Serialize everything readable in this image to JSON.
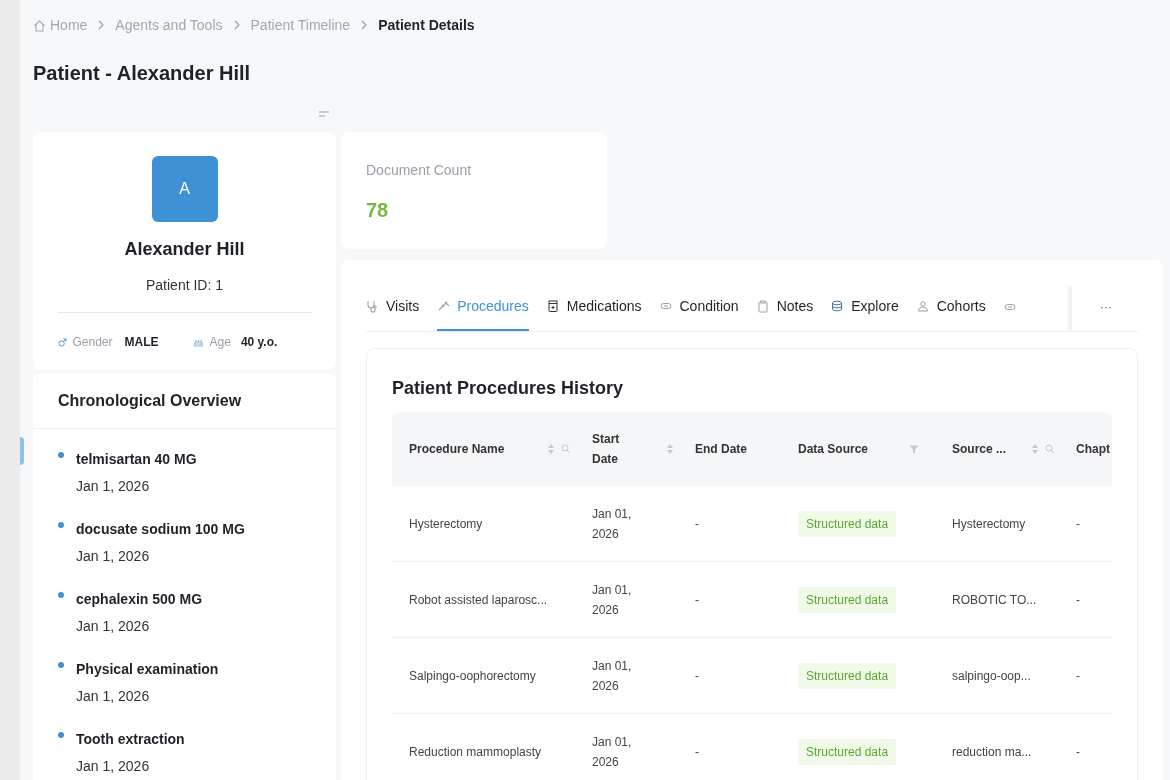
{
  "breadcrumb": [
    {
      "label": "Home",
      "kind": "home"
    },
    {
      "label": "Agents and Tools",
      "kind": "link"
    },
    {
      "label": "Patient Timeline",
      "kind": "link"
    },
    {
      "label": "Patient Details",
      "kind": "current"
    }
  ],
  "page_title": "Patient - Alexander Hill",
  "patient": {
    "initial": "A",
    "name": "Alexander Hill",
    "id_text": "Patient ID: 1",
    "gender_label": "Gender",
    "gender": "MALE",
    "age_label": "Age",
    "age": "40 y.o."
  },
  "chronological_overview": {
    "title": "Chronological Overview",
    "items": [
      {
        "title": "telmisartan 40 MG",
        "date": "Jan 1, 2026"
      },
      {
        "title": "docusate sodium 100 MG",
        "date": "Jan 1, 2026"
      },
      {
        "title": "cephalexin 500 MG",
        "date": "Jan 1, 2026"
      },
      {
        "title": "Physical examination",
        "date": "Jan 1, 2026"
      },
      {
        "title": "Tooth extraction",
        "date": "Jan 1, 2026"
      }
    ]
  },
  "document_count": {
    "label": "Document Count",
    "value": "78"
  },
  "tabs": [
    {
      "label": "Visits",
      "selected": false
    },
    {
      "label": "Procedures",
      "selected": true
    },
    {
      "label": "Medications",
      "selected": false
    },
    {
      "label": "Condition",
      "selected": false
    },
    {
      "label": "Notes",
      "selected": false
    },
    {
      "label": "Explore",
      "selected": false
    },
    {
      "label": "Cohorts",
      "selected": false
    }
  ],
  "more_tabs": "···",
  "table": {
    "title": "Patient Procedures History",
    "columns": [
      {
        "label": "Procedure Name",
        "sortable": true,
        "searchable": true,
        "filterable": false
      },
      {
        "label": "Start Date",
        "sortable": true,
        "searchable": false,
        "filterable": false
      },
      {
        "label": "End Date",
        "sortable": false,
        "searchable": false,
        "filterable": false
      },
      {
        "label": "Data Source",
        "sortable": false,
        "searchable": false,
        "filterable": true
      },
      {
        "label": "Source ...",
        "sortable": true,
        "searchable": true,
        "filterable": false
      },
      {
        "label": "Chapt"
      }
    ],
    "rows": [
      [
        "Hysterectomy",
        "Jan 01, 2026",
        "-",
        "Structured data",
        "Hysterectomy",
        "-"
      ],
      [
        "Robot assisted laparosc...",
        "Jan 01, 2026",
        "-",
        "Structured data",
        "ROBOTIC TO...",
        "-"
      ],
      [
        "Salpingo-oophorectomy",
        "Jan 01, 2026",
        "-",
        "Structured data",
        "salpingo-oop...",
        "-"
      ],
      [
        "Reduction mammoplasty",
        "Jan 01, 2026",
        "-",
        "Structured data",
        "reduction ma...",
        "-"
      ]
    ]
  }
}
